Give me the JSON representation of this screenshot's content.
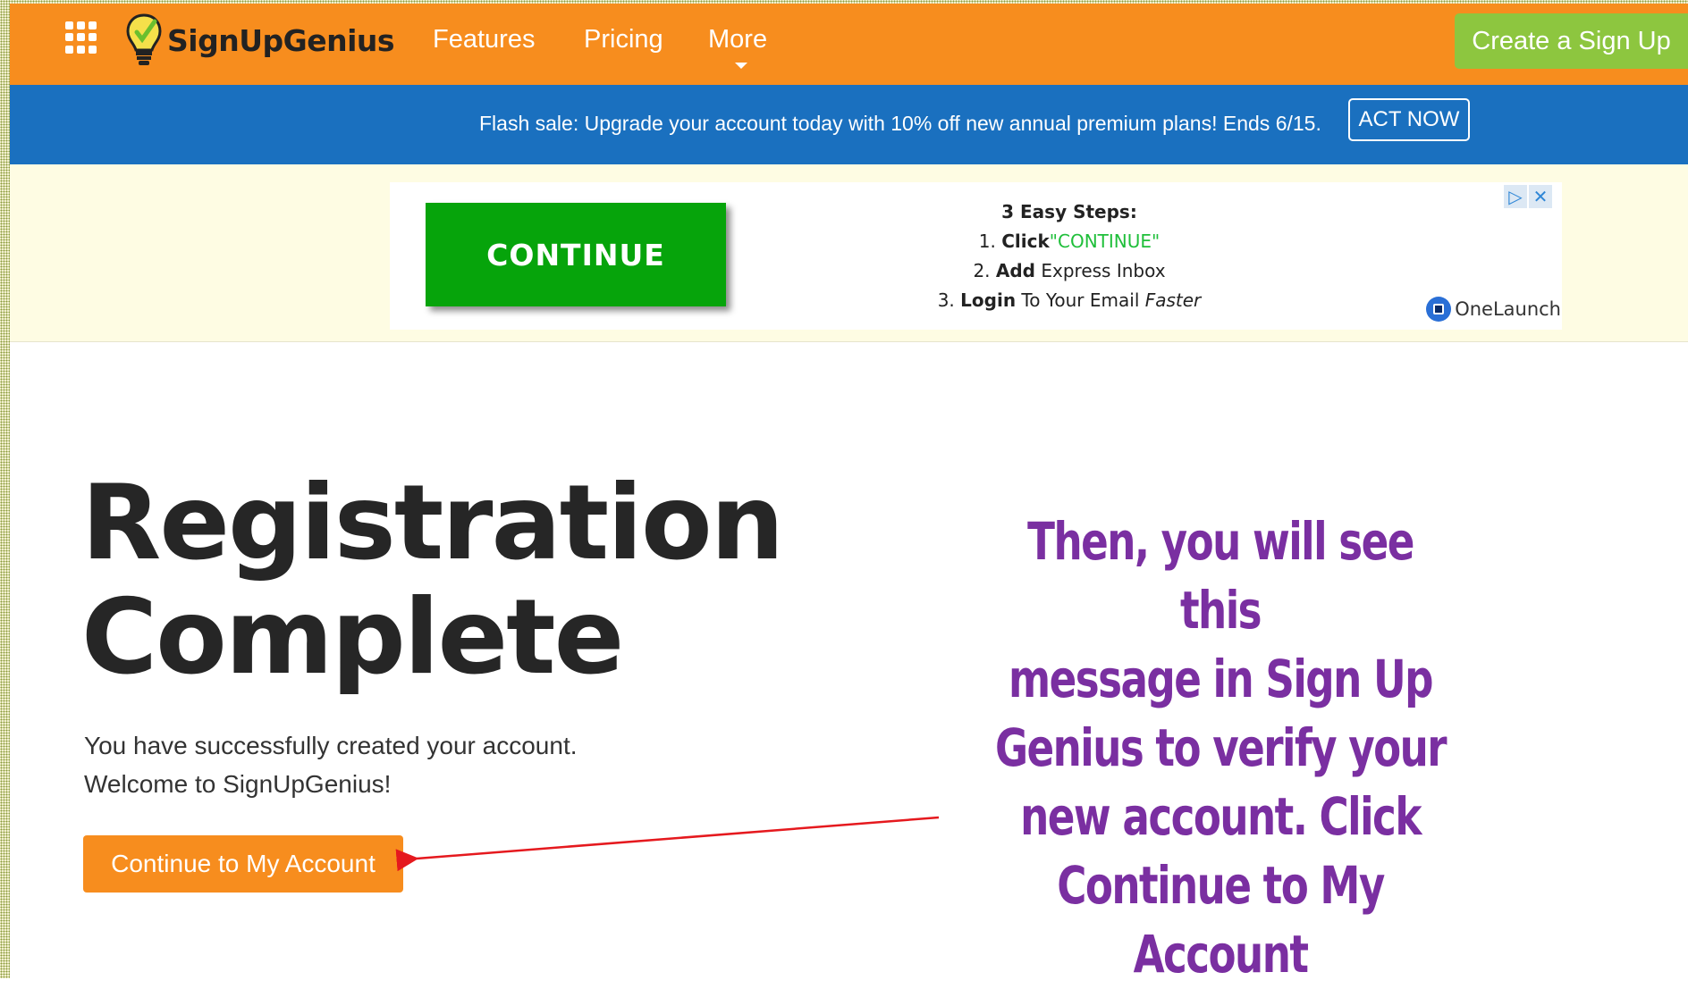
{
  "nav": {
    "brand": "SignUpGenius",
    "links": [
      {
        "label": "Features"
      },
      {
        "label": "Pricing"
      },
      {
        "label": "More"
      }
    ],
    "cta_label": "Create a Sign Up"
  },
  "flash": {
    "text": "Flash sale: Upgrade your account today with 10% off new annual premium plans! Ends 6/15.",
    "button_label": "ACT NOW"
  },
  "ad": {
    "continue_label": "CONTINUE",
    "steps_title": "3 Easy Steps:",
    "step1_prefix": "1. ",
    "step1_bold": "Click",
    "step1_quote": "\"CONTINUE\"",
    "step2_prefix": "2. ",
    "step2_bold": "Add",
    "step2_rest": " Express Inbox",
    "step3_prefix": "3. ",
    "step3_bold": "Login",
    "step3_rest": " To Your Email ",
    "step3_italic": "Faster",
    "advertiser": "OneLaunch"
  },
  "main": {
    "heading_line1": "Registration",
    "heading_line2": "Complete",
    "message_line1": "You have successfully created your account.",
    "message_line2": "Welcome to SignUpGenius!",
    "button_label": "Continue to My Account"
  },
  "annotation": {
    "line1": "Then, you will see this",
    "line2": "message in Sign Up",
    "line3": "Genius to verify your",
    "line4": "new account. Click",
    "line5": "Continue to My Account"
  },
  "colors": {
    "nav_orange": "#f78d1e",
    "cta_green": "#8dc63f",
    "banner_blue": "#1a70bf",
    "ad_green": "#06a40b",
    "annotation_purple": "#7a2fa1",
    "arrow_red": "#e5191e"
  }
}
